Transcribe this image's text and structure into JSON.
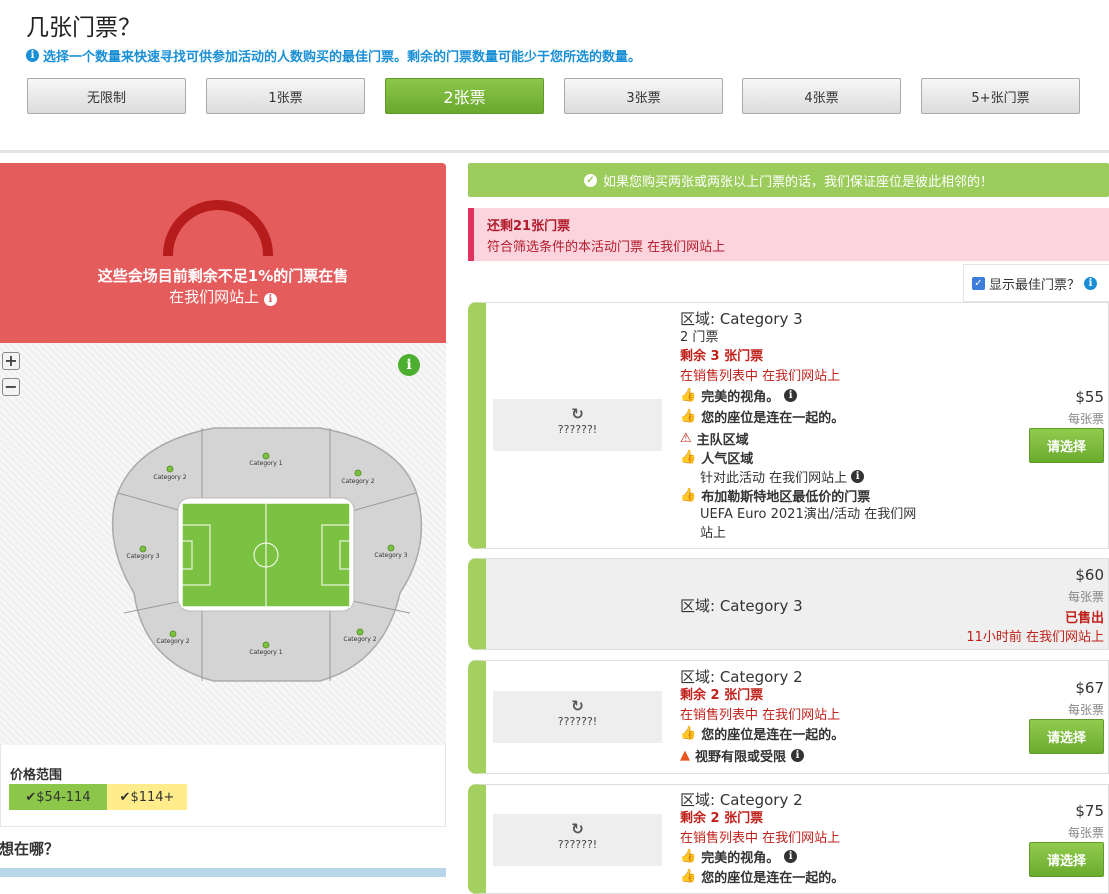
{
  "header": {
    "title": "几张门票？",
    "hint": "选择一个数量来快速寻找可供参加活动的人数购买的最佳门票。剩余的门票数量可能少于您所选的数量。"
  },
  "quantity_options": [
    "无限制",
    "1张票",
    "2张票",
    "3张票",
    "4张票",
    "5+张门票"
  ],
  "quantity_selected": "2张票",
  "scarcity": {
    "line1": "这些会场目前剩余不足1%的门票在售",
    "line2": "在我们网站上"
  },
  "map": {
    "zoom_in": "+",
    "zoom_out": "−",
    "sections": {
      "top_mid": "Category 1",
      "top_left": "Category 2",
      "top_right": "Category 2",
      "left": "Category 3",
      "right": "Category 3",
      "bottom_left": "Category 2",
      "bottom_mid": "Category 1",
      "bottom_right": "Category 2"
    }
  },
  "price_range": {
    "title": "价格范围",
    "chips": [
      "$54-114",
      "$114+"
    ]
  },
  "where_title": "你想在哪？",
  "guarantee": "如果您购买两张或两张以上门票的话，我们保证座位是彼此相邻的！",
  "remaining": {
    "title": "还剩21张门票",
    "subtitle": "符合筛选条件的本活动门票 在我们网站上"
  },
  "show_best": "显示最佳门票？",
  "listings": [
    {
      "zone": "区域: Category 3",
      "count": "2 门票",
      "left": "剩余 3 张门票",
      "status": "在销售列表中 在我们网站上",
      "thumb_text": "??????!",
      "features": [
        "完美的视角。",
        "您的座位是连在一起的。",
        "主队区域",
        "人气区域",
        "针对此活动 在我们网站上",
        "布加勒斯特地区最低价的门票",
        "UEFA Euro 2021演出/活动 在我们网站上"
      ],
      "price": "$55",
      "per": "每张票",
      "button": "请选择"
    },
    {
      "zone": "区域: Category 3",
      "price": "$60",
      "per": "每张票",
      "sold": "已售出",
      "sold_time": "11小时前 在我们网站上"
    },
    {
      "zone": "区域: Category 2",
      "left": "剩余 2 张门票",
      "status": "在销售列表中 在我们网站上",
      "thumb_text": "??????!",
      "features": [
        "您的座位是连在一起的。",
        "视野有限或受限"
      ],
      "price": "$67",
      "per": "每张票",
      "button": "请选择"
    },
    {
      "zone": "区域: Category 2",
      "left": "剩余 2 张门票",
      "status": "在销售列表中 在我们网站上",
      "thumb_text": "??????!",
      "features": [
        "完美的视角。",
        "您的座位是连在一起的。"
      ],
      "price": "$75",
      "per": "每张票",
      "button": "请选择"
    }
  ],
  "colors": {
    "accent_green": "#6aab2d",
    "alert_red": "#e45c5c",
    "info_blue": "#1a8fd6",
    "price_low": "#8cc74a",
    "price_high": "#ffec8b"
  }
}
